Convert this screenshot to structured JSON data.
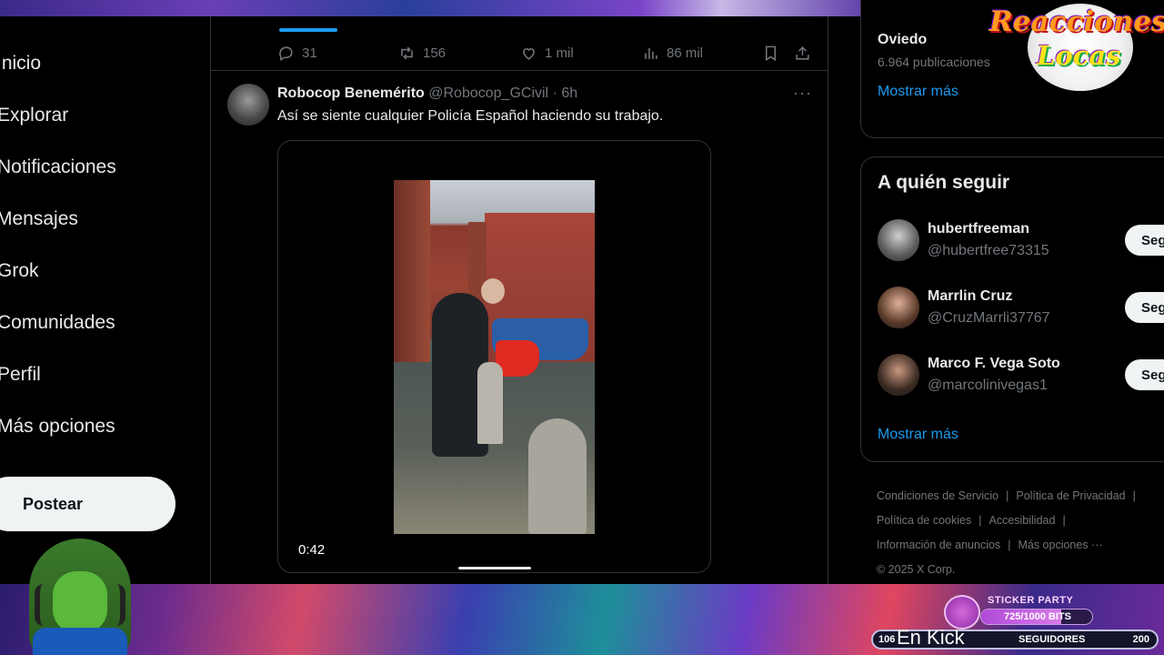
{
  "sidebar": {
    "items": [
      "Inicio",
      "Explorar",
      "Notificaciones",
      "Mensajes",
      "Grok",
      "Comunidades",
      "Perfil",
      "Más opciones"
    ],
    "post_label": "Postear"
  },
  "prev_tweet_actions": {
    "replies": "31",
    "reposts": "156",
    "likes": "1 mil",
    "views": "86 mil"
  },
  "tweet": {
    "name": "Robocop Benemérito",
    "handle": "@Robocop_GCivil",
    "time": "· 6h",
    "text": "Así se siente cualquier Policía Español haciendo su trabajo.",
    "video_time": "0:42",
    "more_label": "···"
  },
  "trend": {
    "title": "Oviedo",
    "count": "6.964 publicaciones",
    "show_more": "Mostrar más"
  },
  "who_to_follow": {
    "title": "A quién seguir",
    "follow_label": "Seguir",
    "users": [
      {
        "name": "hubertfreeman",
        "handle": "@hubertfree73315"
      },
      {
        "name": "Marrlin Cruz",
        "handle": "@CruzMarrli37767"
      },
      {
        "name": "Marco F. Vega Soto",
        "handle": "@marcolinivegas1"
      }
    ],
    "show_more": "Mostrar más"
  },
  "footer": {
    "terms": "Condiciones de Servicio",
    "privacy": "Política de Privacidad",
    "cookies": "Política de cookies",
    "accessibility": "Accesibilidad",
    "ads": "Información de anuncios",
    "more": "Más opciones ···",
    "copyright": "© 2025 X Corp."
  },
  "overlay": {
    "logo_line1": "Reacciones",
    "logo_line2": "Locas",
    "sticker_title": "STICKER PARTY",
    "bits_text": "725/1000 BITS",
    "bits_fraction": 0.725,
    "followers_start": "106",
    "followers_label": "SEGUIDORES",
    "followers_end": "200",
    "en_kick": "En Kick"
  },
  "colors": {
    "accent": "#1d9bf0",
    "text": "#e7e9ea",
    "muted": "#71767b",
    "border": "#2f3336"
  }
}
